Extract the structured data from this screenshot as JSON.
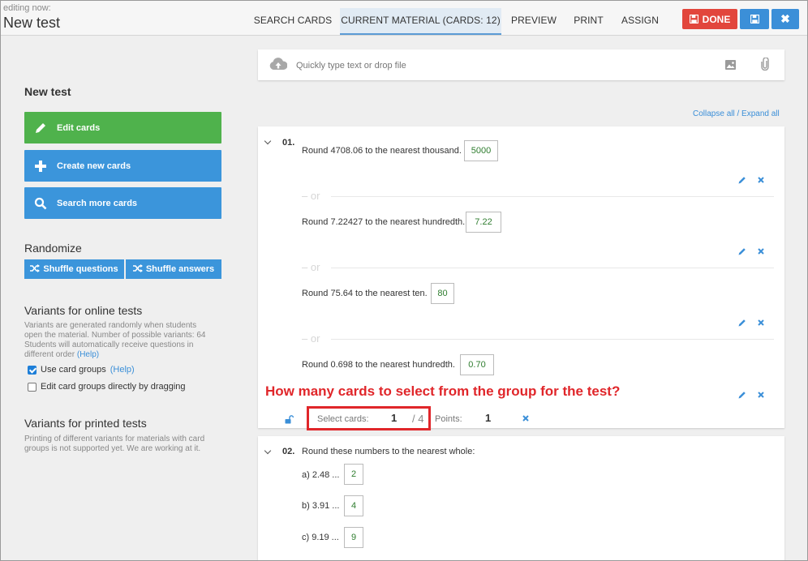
{
  "header": {
    "editing_label": "editing now:",
    "title": "New test",
    "tabs": [
      {
        "label": "SEARCH CARDS",
        "active": false
      },
      {
        "label": "CURRENT MATERIAL (CARDS: 12)",
        "active": true
      },
      {
        "label": "PREVIEW",
        "active": false
      },
      {
        "label": "PRINT",
        "active": false
      },
      {
        "label": "ASSIGN",
        "active": false
      }
    ],
    "done_label": "DONE",
    "done_icon": "floppy-icon",
    "save_icon": "floppy-icon",
    "close_icon": "close-icon",
    "colors": {
      "done": "#e2463c",
      "accent": "#3b8fd8"
    }
  },
  "sidebar": {
    "title": "New test",
    "buttons": [
      {
        "label": "Edit cards",
        "icon": "pencil-icon",
        "color": "#4fb24c"
      },
      {
        "label": "Create new cards",
        "icon": "plus-icon",
        "color": "#3b95db"
      },
      {
        "label": "Search more cards",
        "icon": "search-icon",
        "color": "#3b95db"
      }
    ],
    "randomize": {
      "title": "Randomize",
      "shuffle_questions": "Shuffle questions",
      "shuffle_answers": "Shuffle answers"
    },
    "online": {
      "title": "Variants for online tests",
      "desc_lines": [
        "Variants are generated randomly when students",
        "open the material. Number of possible variants: 64",
        "Students will automatically receive questions in"
      ],
      "desc_last": "different order",
      "help": "(Help)",
      "use_groups_label": "Use card groups",
      "use_groups_checked": true,
      "edit_groups_label": "Edit card groups directly by dragging",
      "edit_groups_checked": false
    },
    "printed": {
      "title": "Variants for printed tests",
      "desc_lines": [
        "Printing of different variants for materials with card",
        "groups is not supported yet. We are working at it."
      ]
    }
  },
  "main": {
    "upload_placeholder": "Quickly type text or drop file",
    "collapse_all": "Collapse all",
    "expand_all": "Expand all",
    "divider": "/",
    "or_label": "or",
    "annotation": "How many cards to select from the group for the test?",
    "q1": {
      "number": "01.",
      "items": [
        {
          "text": "Round 4708.06 to the nearest thousand.",
          "answer": "5000"
        },
        {
          "text": "Round 7.22427 to the nearest hundredth.",
          "answer": "7.22"
        },
        {
          "text": "Round 75.64 to the nearest ten.",
          "answer": "80"
        },
        {
          "text": "Round 0.698 to the nearest hundredth.",
          "answer": "0.70"
        }
      ],
      "select_label": "Select cards:",
      "select_value": "1",
      "select_total": "/ 4",
      "points_label": "Points:",
      "points_value": "1"
    },
    "q2": {
      "number": "02.",
      "text": "Round these numbers to the nearest whole:",
      "items": [
        {
          "label": "a) 2.48 ...",
          "answer": "2"
        },
        {
          "label": "b) 3.91 ...",
          "answer": "4"
        },
        {
          "label": "c) 9.19 ...",
          "answer": "9"
        }
      ]
    }
  }
}
